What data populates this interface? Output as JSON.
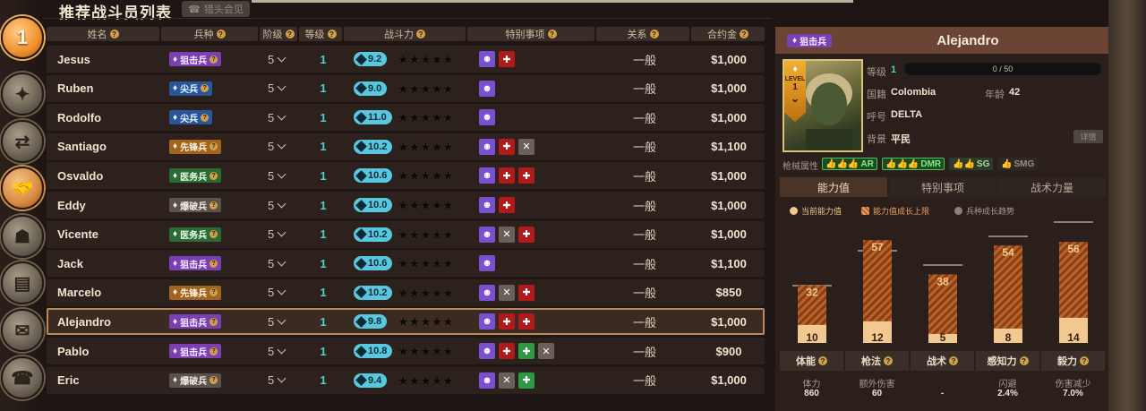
{
  "page": {
    "title": "推荐战斗员列表",
    "head_button": "猎头会见"
  },
  "nav": {
    "badge_number": "1",
    "icons": [
      "rank-medal-icon",
      "skills-icon",
      "routes-icon",
      "handshake-icon",
      "operator-icon",
      "terminal-icon",
      "mailbox-icon",
      "phone-icon"
    ]
  },
  "table": {
    "headers": {
      "name": "姓名",
      "class": "兵种",
      "tier": "阶级",
      "level": "等级",
      "power": "战斗力",
      "traits": "特别事项",
      "relation": "关系",
      "contract": "合约金"
    },
    "rows": [
      {
        "name": "Jesus",
        "class": "狙击兵",
        "class_type": "sniper",
        "tier": "5",
        "level": "1",
        "power": "9.2",
        "traits": [
          "purple",
          "red"
        ],
        "relation": "一般",
        "money": "$1,000"
      },
      {
        "name": "Ruben",
        "class": "尖兵",
        "class_type": "pointman",
        "tier": "5",
        "level": "1",
        "power": "9.0",
        "traits": [
          "purple"
        ],
        "relation": "一般",
        "money": "$1,000"
      },
      {
        "name": "Rodolfo",
        "class": "尖兵",
        "class_type": "pointman",
        "tier": "5",
        "level": "1",
        "power": "11.0",
        "traits": [
          "purple"
        ],
        "relation": "一般",
        "money": "$1,000"
      },
      {
        "name": "Santiago",
        "class": "先锋兵",
        "class_type": "vanguard",
        "tier": "5",
        "level": "1",
        "power": "10.2",
        "traits": [
          "purple",
          "red",
          "grey"
        ],
        "relation": "一般",
        "money": "$1,100"
      },
      {
        "name": "Osvaldo",
        "class": "医务兵",
        "class_type": "medic",
        "tier": "5",
        "level": "1",
        "power": "10.6",
        "traits": [
          "purple",
          "red",
          "red"
        ],
        "relation": "一般",
        "money": "$1,000"
      },
      {
        "name": "Eddy",
        "class": "爆破兵",
        "class_type": "breacher",
        "tier": "5",
        "level": "1",
        "power": "10.0",
        "traits": [
          "purple",
          "red"
        ],
        "relation": "一般",
        "money": "$1,000"
      },
      {
        "name": "Vicente",
        "class": "医务兵",
        "class_type": "medic",
        "tier": "5",
        "level": "1",
        "power": "10.2",
        "traits": [
          "purple",
          "grey",
          "red"
        ],
        "relation": "一般",
        "money": "$1,000"
      },
      {
        "name": "Jack",
        "class": "狙击兵",
        "class_type": "sniper",
        "tier": "5",
        "level": "1",
        "power": "10.6",
        "traits": [
          "purple"
        ],
        "relation": "一般",
        "money": "$1,100"
      },
      {
        "name": "Marcelo",
        "class": "先锋兵",
        "class_type": "vanguard",
        "tier": "5",
        "level": "1",
        "power": "10.2",
        "traits": [
          "purple",
          "grey",
          "red"
        ],
        "relation": "一般",
        "money": "$850"
      },
      {
        "name": "Alejandro",
        "class": "狙击兵",
        "class_type": "sniper",
        "tier": "5",
        "level": "1",
        "power": "9.8",
        "traits": [
          "purple",
          "red",
          "red"
        ],
        "relation": "一般",
        "money": "$1,000",
        "selected": true
      },
      {
        "name": "Pablo",
        "class": "狙击兵",
        "class_type": "sniper",
        "tier": "5",
        "level": "1",
        "power": "10.8",
        "traits": [
          "purple",
          "red",
          "green",
          "grey"
        ],
        "relation": "一般",
        "money": "$900"
      },
      {
        "name": "Eric",
        "class": "爆破兵",
        "class_type": "breacher",
        "tier": "5",
        "level": "1",
        "power": "9.4",
        "traits": [
          "purple",
          "grey",
          "green"
        ],
        "relation": "一般",
        "money": "$1,000"
      }
    ]
  },
  "detail": {
    "class": "狙击兵",
    "name": "Alejandro",
    "portrait_level_label": "LEVEL",
    "portrait_level": "1",
    "labels": {
      "level": "等级",
      "country": "国籍",
      "age": "年龄",
      "callsign": "呼号",
      "background": "背景",
      "detail_button": "详情",
      "weapons": "枪械属性"
    },
    "level": "1",
    "xp": "0 / 50",
    "country": "Colombia",
    "age": "42",
    "callsign": "DELTA",
    "background": "平民",
    "weapons": [
      {
        "name": "AR",
        "grade": "hi"
      },
      {
        "name": "DMR",
        "grade": "hi"
      },
      {
        "name": "SG",
        "grade": "mid"
      },
      {
        "name": "SMG",
        "grade": "lo"
      }
    ],
    "tabs": [
      "能力值",
      "特别事项",
      "战术力量"
    ],
    "legend": [
      "当前能力值",
      "能力值成长上限",
      "兵种成长趋势"
    ],
    "colors": {
      "current": "#f0c890",
      "cap": "#b8642a",
      "trend": "#8a8078"
    },
    "chart_data": {
      "type": "bar",
      "categories": [
        "体能",
        "枪法",
        "战术",
        "感知力",
        "毅力"
      ],
      "series": [
        {
          "name": "当前能力值",
          "values": [
            10,
            12,
            5,
            8,
            14
          ]
        },
        {
          "name": "能力值成长上限",
          "values": [
            32,
            57,
            38,
            54,
            56
          ]
        }
      ],
      "ylim": [
        0,
        100
      ]
    },
    "stats": [
      {
        "label": "体能",
        "sub": "体力",
        "value": "860"
      },
      {
        "label": "枪法",
        "sub": "额外伤害",
        "value": "60"
      },
      {
        "label": "战术",
        "sub": "",
        "value": "-"
      },
      {
        "label": "感知力",
        "sub": "闪避",
        "value": "2.4%"
      },
      {
        "label": "毅力",
        "sub": "伤害减少",
        "value": "7.0%"
      }
    ]
  }
}
